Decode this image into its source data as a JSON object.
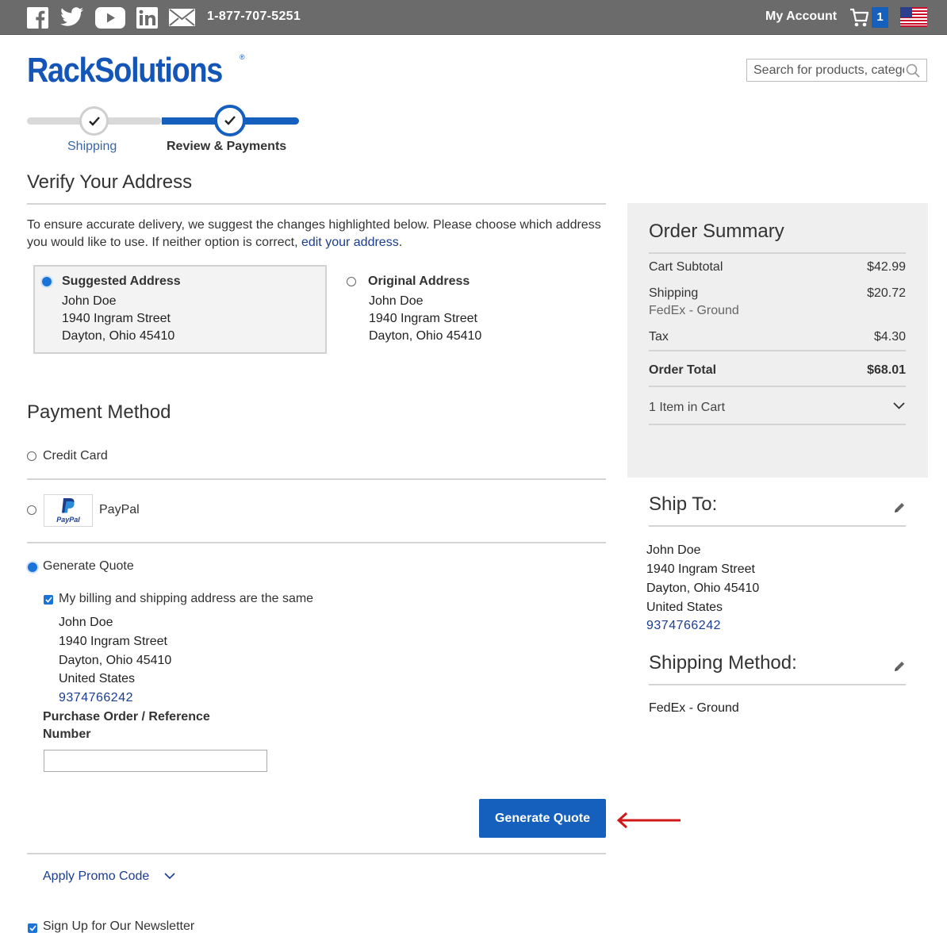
{
  "topbar": {
    "phone": "1-877-707-5251",
    "account_label": "My Account",
    "cart_count": "1",
    "social_icons": [
      "facebook-icon",
      "twitter-icon",
      "youtube-icon",
      "linkedin-icon",
      "email-icon"
    ]
  },
  "header": {
    "logo_text": "RackSolutions",
    "logo_mark": "®",
    "search_placeholder": "Search for products, categories..."
  },
  "progress": {
    "steps": [
      {
        "label": "Shipping"
      },
      {
        "label": "Review & Payments"
      }
    ]
  },
  "verify": {
    "title": "Verify Your Address",
    "intro": "To ensure accurate delivery, we suggest the changes highlighted below. Please choose which address you would like to use. If neither option is correct, ",
    "edit_link": "edit your address",
    "intro_end": ".",
    "suggested": {
      "title": "Suggested Address",
      "lines": [
        "John Doe",
        "1940 Ingram Street",
        "Dayton, Ohio 45410"
      ]
    },
    "original": {
      "title": "Original Address",
      "lines": [
        "John Doe",
        "1940 Ingram Street",
        "Dayton, Ohio 45410"
      ]
    }
  },
  "payment": {
    "title": "Payment Method",
    "options": [
      "Credit Card",
      "PayPal",
      "Generate Quote"
    ],
    "paypal_logo_text": "PayPal",
    "same_address_label": "My billing and shipping address are the same",
    "billing_lines": [
      "John Doe",
      "1940 Ingram Street",
      "Dayton, Ohio 45410",
      "United States"
    ],
    "billing_phone": "9374766242",
    "po_label": "Purchase Order / Reference Number",
    "po_value": "",
    "submit_label": "Generate Quote",
    "promo_label": "Apply Promo Code",
    "newsletter_label": "Sign Up for Our Newsletter"
  },
  "summary": {
    "title": "Order Summary",
    "cart_subtotal_label": "Cart Subtotal",
    "cart_subtotal": "$42.99",
    "shipping_label": "Shipping",
    "shipping_value": "$20.72",
    "shipping_method": "FedEx - Ground",
    "tax_label": "Tax",
    "tax_value": "$4.30",
    "total_label": "Order Total",
    "total_value": "$68.01",
    "items_label": "1 Item in Cart"
  },
  "ship_to": {
    "title": "Ship To:",
    "lines": [
      "John Doe",
      "1940 Ingram Street",
      "Dayton, Ohio 45410",
      "United States"
    ],
    "phone": "9374766242"
  },
  "shipping_method": {
    "title": "Shipping Method:",
    "value": "FedEx - Ground"
  },
  "colors": {
    "brand_blue": "#1560bd",
    "topbar": "#6b6b6b",
    "link": "#1a3d8f",
    "annotation_arrow": "#d01818"
  }
}
